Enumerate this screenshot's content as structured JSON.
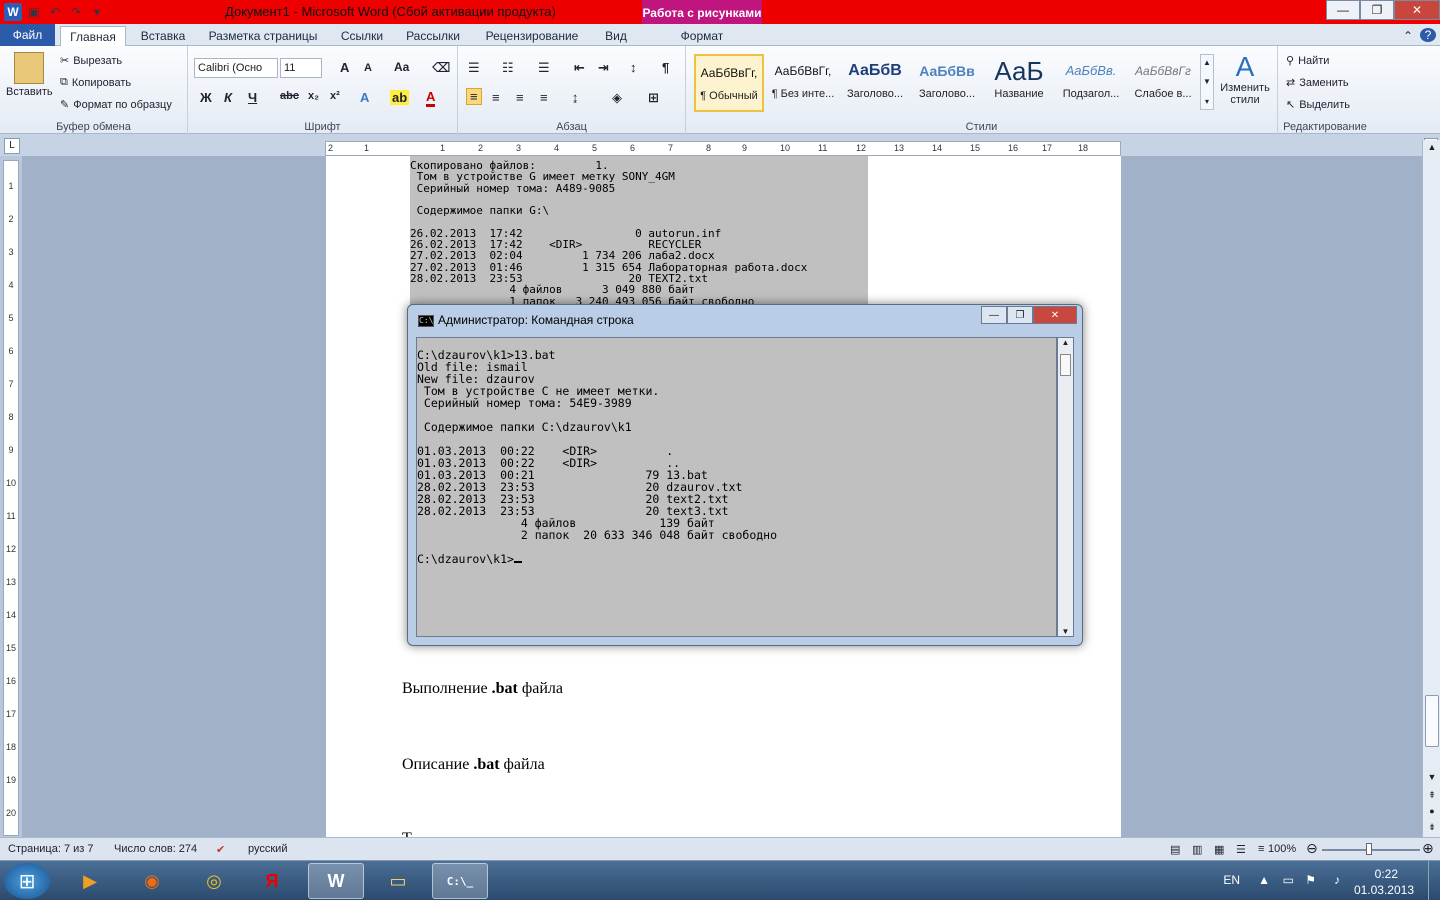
{
  "window": {
    "title": "Документ1 - Microsoft Word (Сбой активации продукта)",
    "context_tab": "Работа с рисунками",
    "context_sub": "Формат"
  },
  "tabs": [
    "Файл",
    "Главная",
    "Вставка",
    "Разметка страницы",
    "Ссылки",
    "Рассылки",
    "Рецензирование",
    "Вид"
  ],
  "clipboard": {
    "paste": "Вставить",
    "cut": "Вырезать",
    "copy": "Копировать",
    "format_painter": "Формат по образцу",
    "label": "Буфер обмена"
  },
  "font": {
    "name": "Calibri (Осно",
    "size": "11",
    "label": "Шрифт"
  },
  "paragraph": {
    "label": "Абзац"
  },
  "styles": {
    "label": "Стили",
    "change": "Изменить стили",
    "items": [
      {
        "preview": "АаБбВвГг,",
        "name": "¶ Обычный"
      },
      {
        "preview": "АаБбВвГг,",
        "name": "¶ Без инте..."
      },
      {
        "preview": "АаБбВ",
        "name": "Заголово..."
      },
      {
        "preview": "АаБбВв",
        "name": "Заголово..."
      },
      {
        "preview": "АаБ",
        "name": "Название"
      },
      {
        "preview": "АаБбВв.",
        "name": "Подзагол..."
      },
      {
        "preview": "АаБбВвГг",
        "name": "Слабое в..."
      }
    ]
  },
  "editing": {
    "label": "Редактирование",
    "find": "Найти",
    "replace": "Заменить",
    "select": "Выделить"
  },
  "ruler": {
    "h": [
      "2",
      "1",
      "1",
      "2",
      "3",
      "4",
      "5",
      "6",
      "7",
      "8",
      "9",
      "10",
      "11",
      "12",
      "13",
      "14",
      "15",
      "16",
      "17",
      "18"
    ],
    "v": [
      "1",
      "2",
      "3",
      "4",
      "5",
      "6",
      "7",
      "8",
      "9",
      "10",
      "11",
      "12",
      "13",
      "14",
      "15",
      "16",
      "17",
      "18",
      "19",
      "20"
    ]
  },
  "doc_screenshot": "Скопировано файлов:         1.\n Том в устройстве G имеет метку SONY_4GM\n Серийный номер тома: A489-9085\n\n Содержимое папки G:\\\n\n26.02.2013  17:42                 0 autorun.inf\n26.02.2013  17:42    <DIR>          RECYCLER\n27.02.2013  02:04         1 734 206 лаба2.docx\n27.02.2013  01:46         1 315 654 Лабораторная работа.docx\n28.02.2013  23:53                20 TEXT2.txt\n               4 файлов      3 049 880 байт\n               1 папок   3 240 493 056 байт свободно",
  "document": {
    "p1_pre": "Выполнение ",
    "p1_bold": ".bat",
    "p1_post": " файла",
    "p2_pre": "Описание ",
    "p2_bold": ".bat",
    "p2_post": " файла",
    "p3": "Т"
  },
  "cmd": {
    "title": "Администратор: Командная строка",
    "output": "C:\\dzaurov\\k1>13.bat\nOld file: ismail\nNew file: dzaurov\n Том в устройстве C не имеет метки.\n Серийный номер тома: 54E9-3989\n\n Содержимое папки C:\\dzaurov\\k1\n\n01.03.2013  00:22    <DIR>          .\n01.03.2013  00:22    <DIR>          ..\n01.03.2013  00:21                79 13.bat\n28.02.2013  23:53                20 dzaurov.txt\n28.02.2013  23:53                20 text2.txt\n28.02.2013  23:53                20 text3.txt\n               4 файлов            139 байт\n               2 папок  20 633 346 048 байт свободно\n\n",
    "prompt": "C:\\dzaurov\\k1>"
  },
  "status": {
    "page": "Страница: 7 из 7",
    "words": "Число слов: 274",
    "lang": "русский",
    "zoom": "100%"
  },
  "tray": {
    "lang": "EN",
    "time": "0:22",
    "date": "01.03.2013"
  }
}
